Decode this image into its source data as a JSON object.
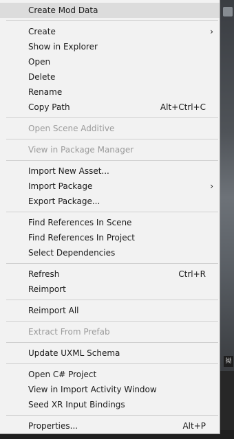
{
  "background": {
    "badge_text": "拗"
  },
  "menu": {
    "items": [
      {
        "label": "Create Mod Data",
        "shortcut": "",
        "submenu": false,
        "enabled": true,
        "highlighted": true
      },
      {
        "label": "Create",
        "shortcut": "",
        "submenu": true,
        "enabled": true
      },
      {
        "label": "Show in Explorer",
        "shortcut": "",
        "submenu": false,
        "enabled": true
      },
      {
        "label": "Open",
        "shortcut": "",
        "submenu": false,
        "enabled": true
      },
      {
        "label": "Delete",
        "shortcut": "",
        "submenu": false,
        "enabled": true
      },
      {
        "label": "Rename",
        "shortcut": "",
        "submenu": false,
        "enabled": true
      },
      {
        "label": "Copy Path",
        "shortcut": "Alt+Ctrl+C",
        "submenu": false,
        "enabled": true
      },
      {
        "label": "Open Scene Additive",
        "shortcut": "",
        "submenu": false,
        "enabled": false
      },
      {
        "label": "View in Package Manager",
        "shortcut": "",
        "submenu": false,
        "enabled": false
      },
      {
        "label": "Import New Asset...",
        "shortcut": "",
        "submenu": false,
        "enabled": true
      },
      {
        "label": "Import Package",
        "shortcut": "",
        "submenu": true,
        "enabled": true
      },
      {
        "label": "Export Package...",
        "shortcut": "",
        "submenu": false,
        "enabled": true
      },
      {
        "label": "Find References In Scene",
        "shortcut": "",
        "submenu": false,
        "enabled": true
      },
      {
        "label": "Find References In Project",
        "shortcut": "",
        "submenu": false,
        "enabled": true
      },
      {
        "label": "Select Dependencies",
        "shortcut": "",
        "submenu": false,
        "enabled": true
      },
      {
        "label": "Refresh",
        "shortcut": "Ctrl+R",
        "submenu": false,
        "enabled": true
      },
      {
        "label": "Reimport",
        "shortcut": "",
        "submenu": false,
        "enabled": true
      },
      {
        "label": "Reimport All",
        "shortcut": "",
        "submenu": false,
        "enabled": true
      },
      {
        "label": "Extract From Prefab",
        "shortcut": "",
        "submenu": false,
        "enabled": false
      },
      {
        "label": "Update UXML Schema",
        "shortcut": "",
        "submenu": false,
        "enabled": true
      },
      {
        "label": "Open C# Project",
        "shortcut": "",
        "submenu": false,
        "enabled": true
      },
      {
        "label": "View in Import Activity Window",
        "shortcut": "",
        "submenu": false,
        "enabled": true
      },
      {
        "label": "Seed XR Input Bindings",
        "shortcut": "",
        "submenu": false,
        "enabled": true
      },
      {
        "label": "Properties...",
        "shortcut": "Alt+P",
        "submenu": false,
        "enabled": true
      }
    ],
    "submenu_arrow": "›"
  }
}
